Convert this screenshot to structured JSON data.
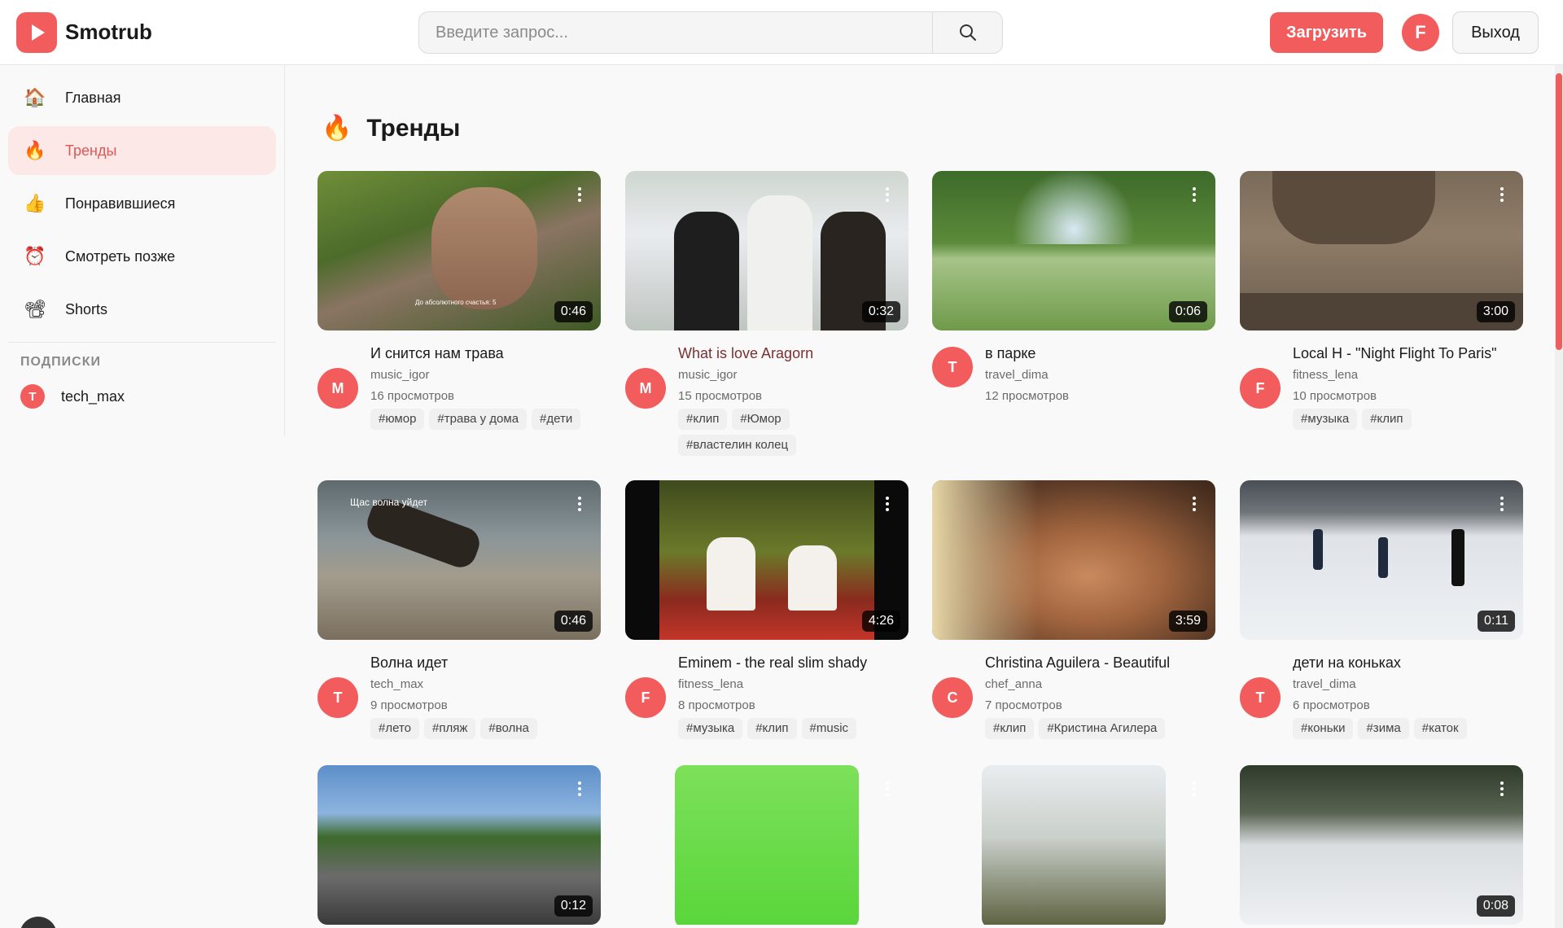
{
  "header": {
    "logo_text": "Smotrub",
    "search_placeholder": "Введите запрос...",
    "upload_label": "Загрузить",
    "user_initial": "F",
    "logout_label": "Выход"
  },
  "sidebar": {
    "items": [
      {
        "label": "Главная",
        "icon": "house-icon"
      },
      {
        "label": "Тренды",
        "icon": "fire-icon"
      },
      {
        "label": "Понравившиеся",
        "icon": "thumbs-up-icon"
      },
      {
        "label": "Смотреть позже",
        "icon": "alarm-clock-icon"
      },
      {
        "label": "Shorts",
        "icon": "film-projector-icon"
      }
    ],
    "subscriptions_title": "ПОДПИСКИ",
    "subscriptions": [
      {
        "initial": "T",
        "name": "tech_max"
      }
    ]
  },
  "main": {
    "section_title": "Тренды",
    "videos": [
      {
        "title": "И снится нам трава",
        "channel": "music_igor",
        "views": "16 просмотров",
        "duration": "0:46",
        "initial": "M",
        "tags": [
          "#юмор",
          "#трава у дома",
          "#дети"
        ],
        "thumb_caption": "До абсолютного счастья: 5"
      },
      {
        "title": "What is love Aragorn",
        "channel": "music_igor",
        "views": "15 просмотров",
        "duration": "0:32",
        "initial": "M",
        "tags": [
          "#клип",
          "#Юмор",
          "#властелин колец"
        ]
      },
      {
        "title": "в парке",
        "channel": "travel_dima",
        "views": "12 просмотров",
        "duration": "0:06",
        "initial": "T",
        "tags": []
      },
      {
        "title": "Local H - \"Night Flight To Paris\"",
        "channel": "fitness_lena",
        "views": "10 просмотров",
        "duration": "3:00",
        "initial": "F",
        "tags": [
          "#музыка",
          "#клип"
        ]
      },
      {
        "title": "Волна идет",
        "channel": "tech_max",
        "views": "9 просмотров",
        "duration": "0:46",
        "initial": "T",
        "tags": [
          "#лето",
          "#пляж",
          "#волна"
        ],
        "thumb_caption": "Щас волна уйдет"
      },
      {
        "title": "Eminem - the real slim shady",
        "channel": "fitness_lena",
        "views": "8 просмотров",
        "duration": "4:26",
        "initial": "F",
        "tags": [
          "#музыка",
          "#клип",
          "#music"
        ]
      },
      {
        "title": "Christina Aguilera - Beautiful",
        "channel": "chef_anna",
        "views": "7 просмотров",
        "duration": "3:59",
        "initial": "C",
        "tags": [
          "#клип",
          "#Кристина Агилера"
        ]
      },
      {
        "title": "дети на коньках",
        "channel": "travel_dima",
        "views": "6 просмотров",
        "duration": "0:11",
        "initial": "T",
        "tags": [
          "#коньки",
          "#зима",
          "#каток"
        ]
      }
    ],
    "partial_durations": [
      "0:12",
      "0:08"
    ]
  },
  "colors": {
    "accent": "#f25c5c",
    "active_bg": "#fde8e8"
  }
}
